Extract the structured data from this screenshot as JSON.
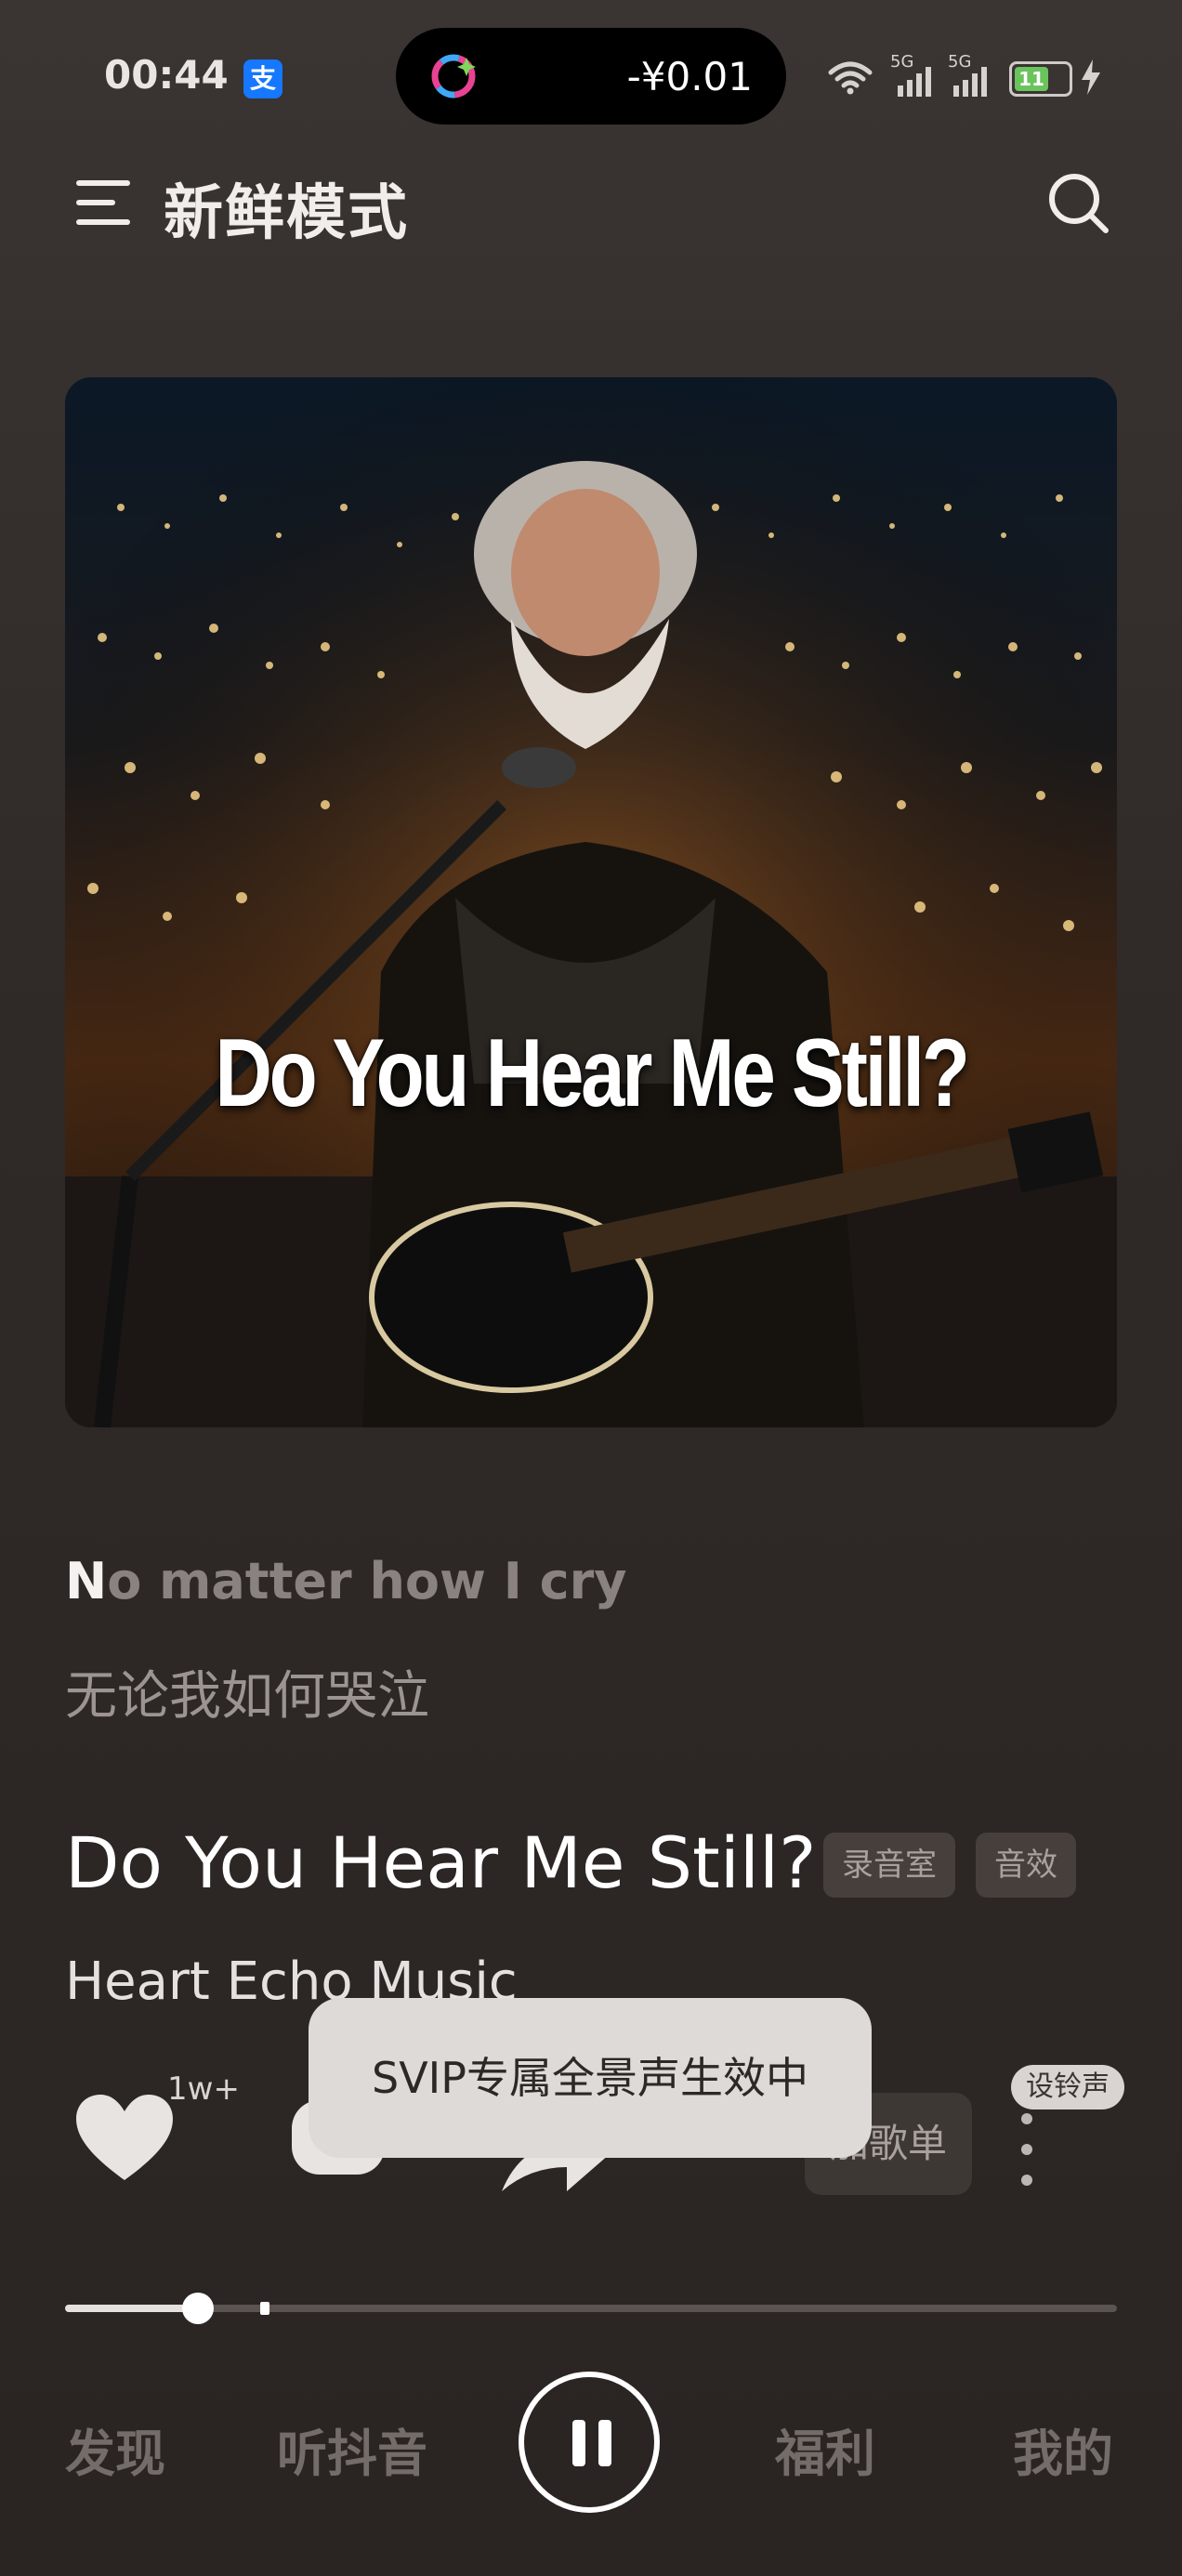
{
  "status_bar": {
    "time": "00:44",
    "alipay_label": "支",
    "island_amount": "-¥0.01",
    "signal1": "5G",
    "signal2": "5G",
    "battery_level": "11"
  },
  "header": {
    "title": "新鲜模式"
  },
  "artwork": {
    "title_text": "Do You Hear Me Still?"
  },
  "lyrics": {
    "current_en_highlight": "N",
    "current_en_rest": "o matter how I cry",
    "current_cn": "无论我如何哭泣"
  },
  "song": {
    "title": "Do You Hear Me Still?",
    "tag_studio": "录音室",
    "tag_effects": "音效",
    "artist": "Heart Echo Music"
  },
  "actions": {
    "like_count": "1w+",
    "add_playlist_label": "加歌单",
    "ringtone_label": "设铃声"
  },
  "toast": {
    "message": "SVIP专属全景声生效中"
  },
  "progress": {
    "played_fraction": 0.126,
    "buffered_fraction": 0.19
  },
  "bottom_nav": {
    "discover": "发现",
    "listen": "听抖音",
    "welfare": "福利",
    "mine": "我的"
  },
  "colors": {
    "background": "#2f2927",
    "accent_text": "#ffffff",
    "muted_text": "#746c69"
  }
}
